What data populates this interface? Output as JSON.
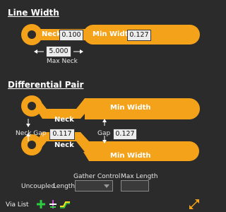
{
  "line_width": {
    "title": "Line Width",
    "neck_label": "Neck",
    "neck_value": "0.100",
    "min_width_label": "Min Width",
    "min_width_value": "0.127",
    "max_neck_value": "5.000",
    "max_neck_label": "Max Neck"
  },
  "diff_pair": {
    "title": "Differential Pair",
    "min_width_label_top": "Min Width",
    "neck_label_top": "Neck",
    "neck_gap_label": "Neck Gap",
    "neck_gap_value": "0.117",
    "gap_label": "Gap",
    "gap_value": "0.127",
    "neck_label_bottom": "Neck",
    "min_width_label_bottom": "Min Width"
  },
  "uncoupled": {
    "gather_control_label": "Gather Control",
    "max_length_label": "Max Length",
    "uncoupled_label": "Uncoupled",
    "length_label": "Length"
  },
  "via_list": {
    "label": "Via List"
  },
  "colors": {
    "trace": "#f5a21b",
    "background": "#2b2b2b",
    "add_icon": "#2ecc40"
  }
}
